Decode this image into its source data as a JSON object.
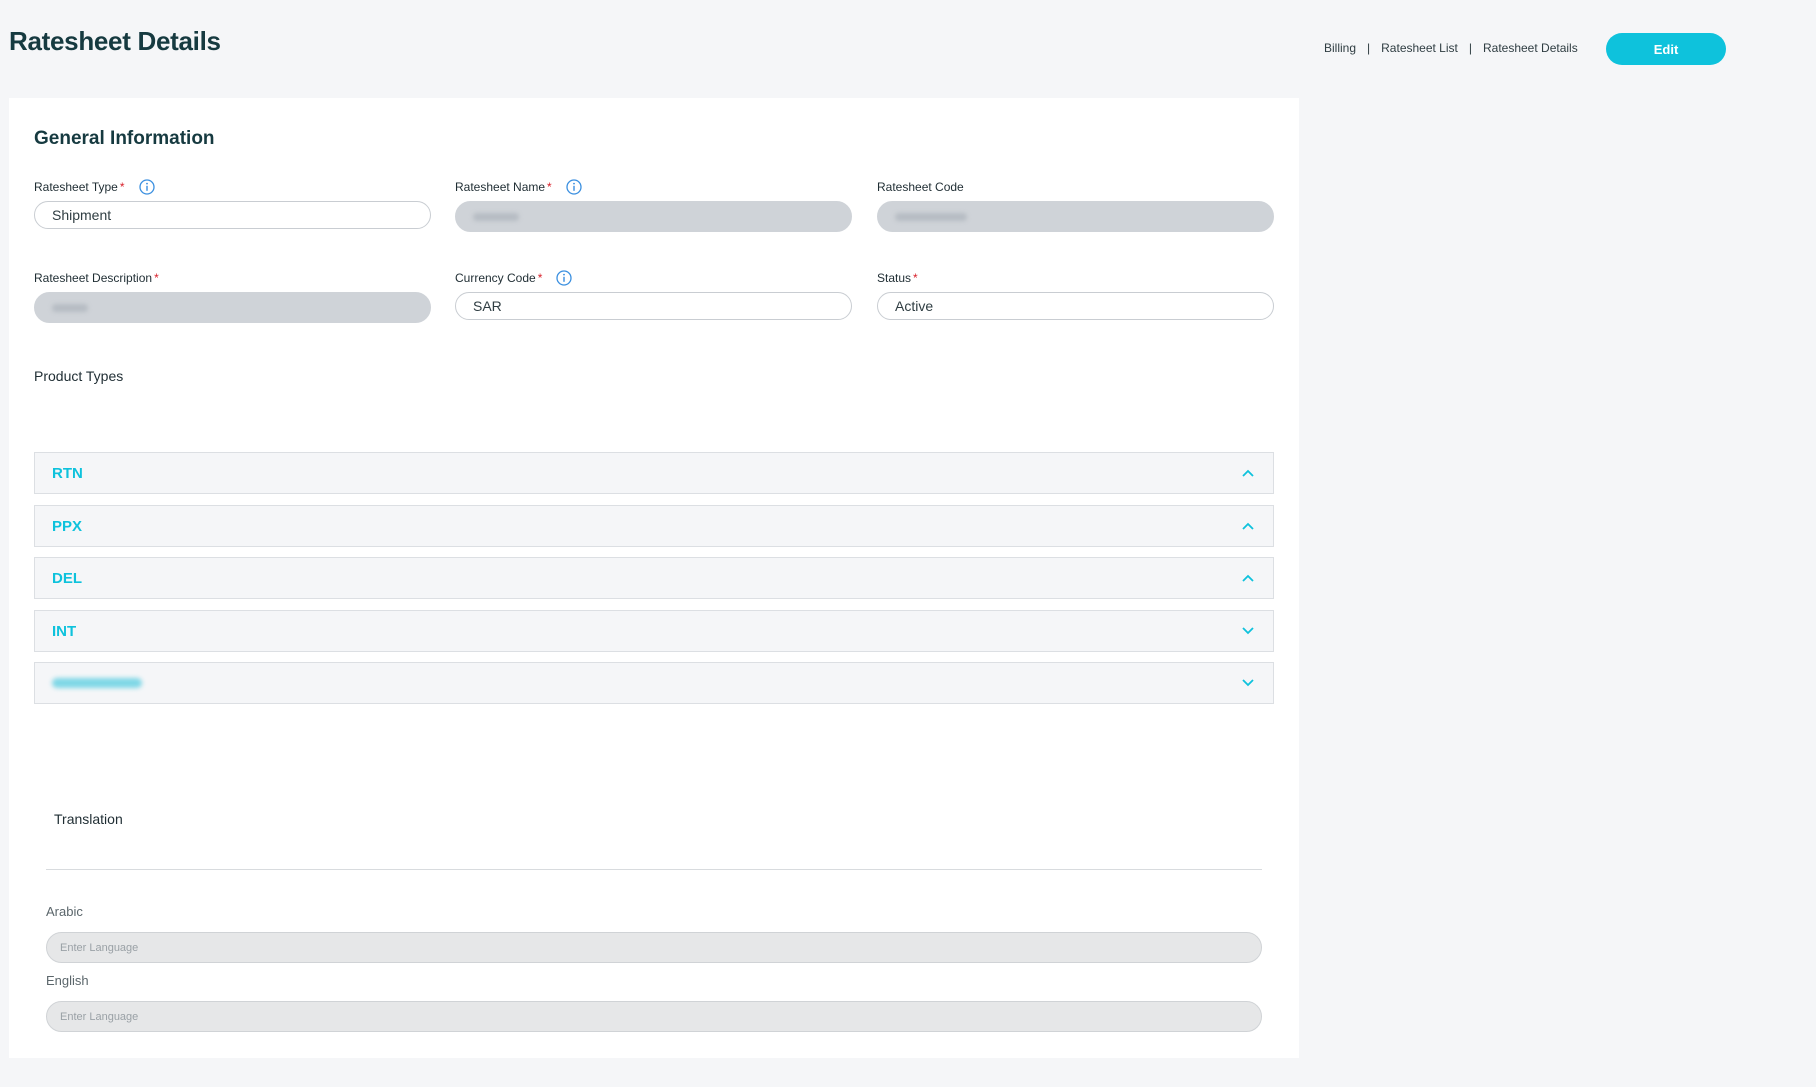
{
  "header": {
    "title": "Ratesheet Details",
    "breadcrumb": [
      "Billing",
      "Ratesheet List",
      "Ratesheet Details"
    ],
    "breadcrumb_separator": "|",
    "edit_label": "Edit"
  },
  "general": {
    "section_title": "General Information",
    "fields": {
      "type": {
        "label": "Ratesheet Type",
        "required": "*",
        "value": "Shipment"
      },
      "name": {
        "label": "Ratesheet Name",
        "required": "*",
        "value": ""
      },
      "code": {
        "label": "Ratesheet Code",
        "value": ""
      },
      "description": {
        "label": "Ratesheet Description",
        "required": "*",
        "value": ""
      },
      "currency": {
        "label": "Currency Code",
        "required": "*",
        "value": "SAR"
      },
      "status": {
        "label": "Status",
        "required": "*",
        "value": "Active"
      }
    }
  },
  "product_types": {
    "label": "Product Types",
    "items": [
      {
        "label": "RTN",
        "state": "expanded"
      },
      {
        "label": "PPX",
        "state": "expanded"
      },
      {
        "label": "DEL",
        "state": "expanded"
      },
      {
        "label": "INT",
        "state": "collapsed"
      },
      {
        "label": "",
        "state": "collapsed"
      }
    ]
  },
  "translation": {
    "title": "Translation",
    "arabic_label": "Arabic",
    "arabic_placeholder": "Enter Language",
    "english_label": "English",
    "english_placeholder": "Enter Language"
  },
  "colors": {
    "accent": "#0ec2dc",
    "title": "#163a40",
    "required": "#d8202a",
    "info_icon": "#3a8fe0",
    "page_bg": "#f5f6f8"
  },
  "icons": {
    "info": "info-circle-icon",
    "expanded": "chevron-up-icon",
    "collapsed": "chevron-down-icon"
  }
}
